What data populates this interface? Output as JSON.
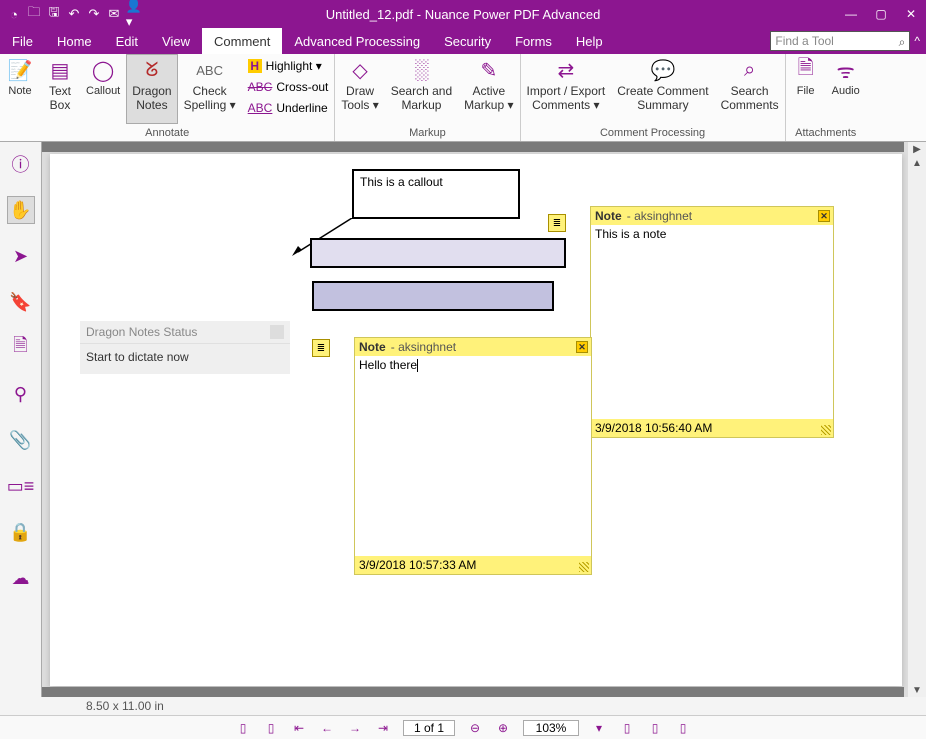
{
  "titlebar": {
    "title": "Untitled_12.pdf - Nuance Power PDF Advanced"
  },
  "menu": {
    "items": [
      "File",
      "Home",
      "Edit",
      "View",
      "Comment",
      "Advanced Processing",
      "Security",
      "Forms",
      "Help"
    ],
    "active": 4
  },
  "search": {
    "placeholder": "Find a Tool"
  },
  "ribbon": {
    "group_annotate": {
      "label": "Annotate",
      "note": "Note",
      "textbox_l1": "Text",
      "textbox_l2": "Box",
      "callout": "Callout",
      "dragon_l1": "Dragon",
      "dragon_l2": "Notes",
      "spell_l1": "Check",
      "spell_l2": "Spelling ▾",
      "highlight": "Highlight ▾",
      "crossout": "Cross-out",
      "underline": "Underline"
    },
    "group_markup": {
      "label": "Markup",
      "draw_l1": "Draw",
      "draw_l2": "Tools ▾",
      "search_l1": "Search and",
      "search_l2": "Markup",
      "active_l1": "Active",
      "active_l2": "Markup ▾"
    },
    "group_comment": {
      "label": "Comment Processing",
      "imp_l1": "Import / Export",
      "imp_l2": "Comments ▾",
      "create_l1": "Create Comment",
      "create_l2": "Summary",
      "srch_l1": "Search",
      "srch_l2": "Comments"
    },
    "group_attach": {
      "label": "Attachments",
      "file": "File",
      "audio": "Audio"
    }
  },
  "dragon_status": {
    "title": "Dragon Notes Status",
    "body": "Start to dictate now"
  },
  "callout_text": "This is a callout",
  "note1": {
    "title": "Note",
    "author": "- aksinghnet",
    "body": "This is a note",
    "ts": "3/9/2018 10:56:40 AM"
  },
  "note2": {
    "title": "Note",
    "author": "- aksinghnet",
    "body": "Hello there",
    "ts": "3/9/2018 10:57:33 AM"
  },
  "status": {
    "dims": "8.50 x 11.00 in",
    "page": "1 of 1",
    "zoom": "103%"
  }
}
